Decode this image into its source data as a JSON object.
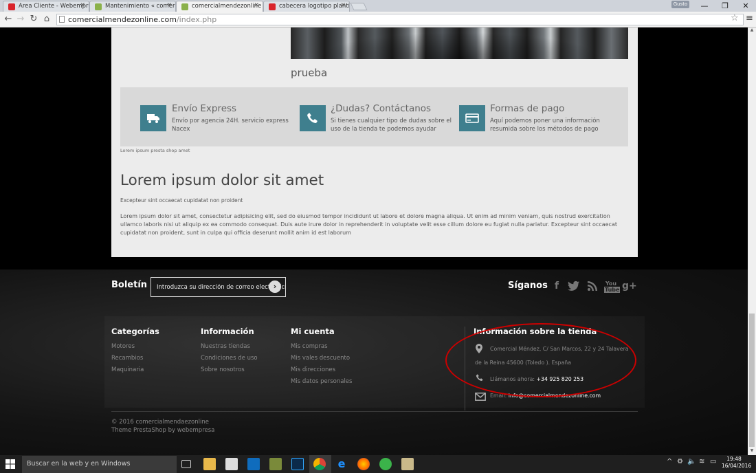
{
  "browser": {
    "tabs": [
      {
        "title": "Área Cliente - Webempresa",
        "favicon_color": "#d9242b",
        "active": false
      },
      {
        "title": "Mantenimiento « comercialm",
        "favicon_color": "#8bb14a",
        "active": false
      },
      {
        "title": "comercialmendezonline",
        "favicon_color": "#8bb14a",
        "active": true
      },
      {
        "title": "cabecera logotipo plantilla",
        "favicon_color": "#d9242b",
        "active": false
      }
    ],
    "user_badge": "Gusto",
    "url_domain": "comercialmendezonline.com",
    "url_path": "/index.php"
  },
  "content": {
    "image_caption": "prueba",
    "features": [
      {
        "title": "Envío Express",
        "desc_line1": "Envío por agencia 24H. servicio express",
        "desc_line2": "Nacex",
        "icon": "truck-icon"
      },
      {
        "title": "¿Dudas? Contáctanos",
        "desc_line1": "Si tienes cualquier tipo de dudas sobre el",
        "desc_line2": "uso de la tienda te podemos ayudar",
        "icon": "phone-icon"
      },
      {
        "title": "Formas de pago",
        "desc_line1": "Aquí podemos poner una información",
        "desc_line2": "resumida sobre los métodos de pago",
        "icon": "credit-card-icon"
      }
    ],
    "tagline": "Lorem ipsum presta shop amet",
    "heading": "Lorem ipsum dolor sit amet",
    "subheading": "Excepteur sint occaecat cupidatat non proident",
    "paragraph": "Lorem ipsum dolor sit amet, consectetur adipisicing elit, sed do eiusmod tempor incididunt ut labore et dolore magna aliqua. Ut enim ad minim veniam, quis nostrud exercitation ullamco laboris nisi ut aliquip ex ea commodo consequat. Duis aute irure dolor in reprehenderit in voluptate velit esse cillum dolore eu fugiat nulla pariatur. Excepteur sint occaecat cupidatat non proident, sunt in culpa qui officia deserunt mollit anim id est laborum"
  },
  "footer": {
    "newsletter_label": "Boletín",
    "newsletter_placeholder": "Introduzca su dirección de correo electrónico",
    "social_label": "Síganos",
    "social": [
      "facebook-icon",
      "twitter-icon",
      "rss-icon",
      "youtube-icon",
      "google-plus-icon"
    ],
    "categories": {
      "title": "Categorías",
      "items": [
        "Motores",
        "Recambios",
        "Maquinaria"
      ]
    },
    "information": {
      "title": "Información",
      "items": [
        "Nuestras tiendas",
        "Condiciones de uso",
        "Sobre nosotros"
      ]
    },
    "account": {
      "title": "Mi cuenta",
      "items": [
        "Mis compras",
        "Mis vales descuento",
        "Mis direcciones",
        "Mis datos personales"
      ]
    },
    "store": {
      "title": "Información sobre la tienda",
      "address_line1": "Comercial Méndez, C/ San Marcos, 22 y 24 Talavera",
      "address_line2": "de la Reina 45600 (Toledo ). España",
      "phone_label": "Llámanos ahora:",
      "phone": "+34 925 820 253",
      "email_label": "Email:",
      "email": "info@comercialmendezonline.com"
    },
    "copyright": "© 2016 comercialmendaezonline",
    "theme": "Theme PrestaShop by webempresa"
  },
  "taskbar": {
    "search_placeholder": "Buscar en la web y en Windows",
    "time": "19:48",
    "date": "16/04/2016"
  },
  "colors": {
    "feature_icon_bg": "#3f7f8e",
    "annotation": "#cc0000"
  }
}
